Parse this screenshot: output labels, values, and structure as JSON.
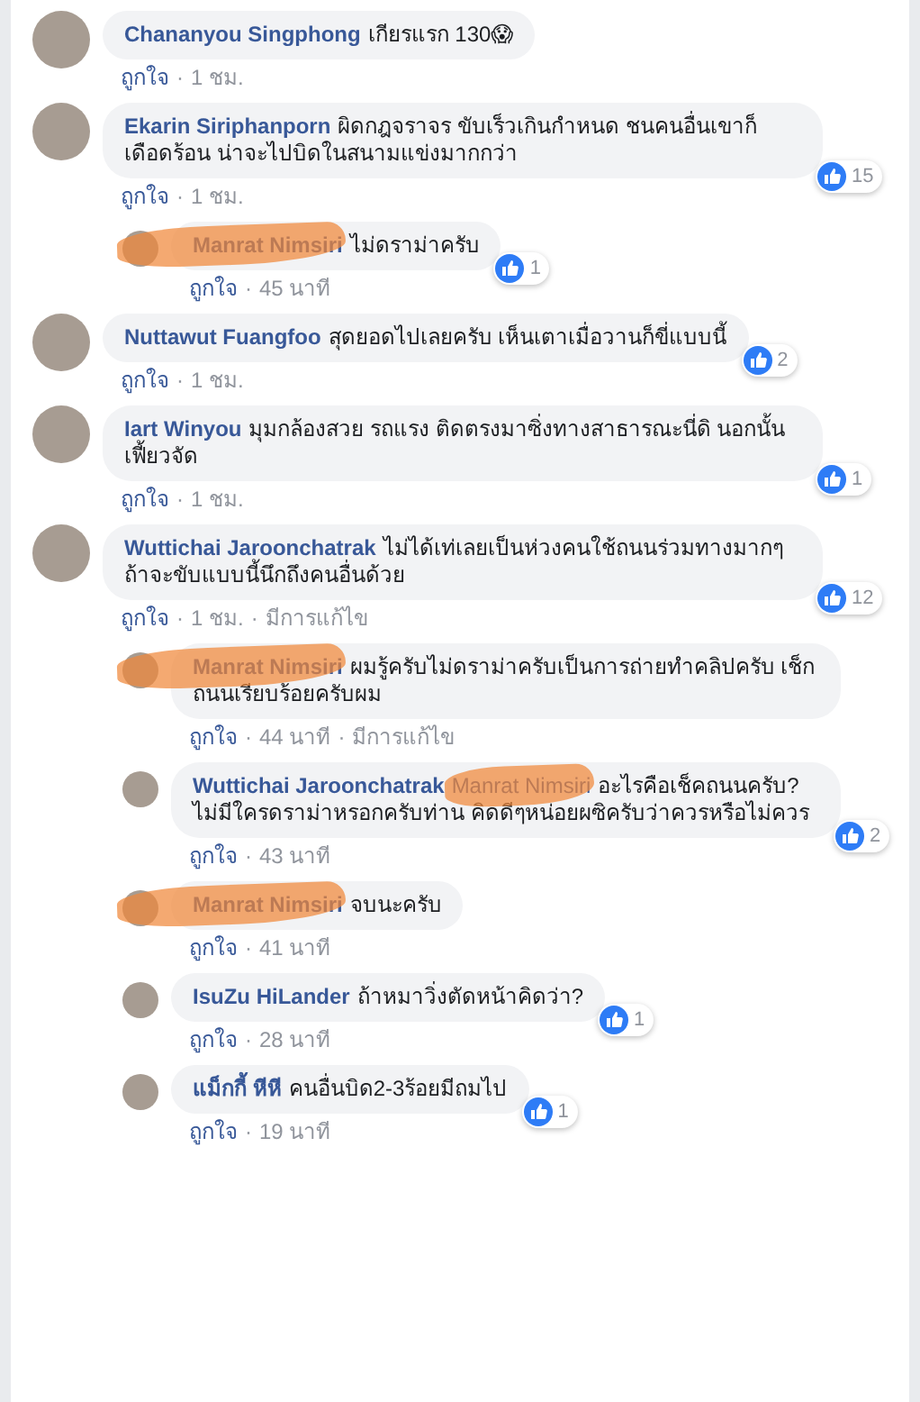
{
  "separator": "·",
  "comments": [
    {
      "author": "Chananyou Singphong",
      "text": "เกียรแรก 130😱",
      "like": "ถูกใจ",
      "time": "1 ชม."
    },
    {
      "author": "Ekarin Siriphanporn",
      "text": "ผิดกฎจราจร ขับเร็วเกินกำหนด ชนคนอื่นเขาก็เดือดร้อน น่าจะไปบิดในสนามแข่งมากกว่า",
      "like": "ถูกใจ",
      "time": "1 ชม.",
      "reactions": "15",
      "replies": [
        {
          "author": "Manrat Nimsiri",
          "text": "ไม่ดราม่าครับ",
          "like": "ถูกใจ",
          "time": "45 นาที",
          "reactions": "1",
          "redacted": true
        }
      ]
    },
    {
      "author": "Nuttawut Fuangfoo",
      "text": "สุดยอดไปเลยครับ เห็นเตาเมื่อวานก็ขี่แบบนี้",
      "like": "ถูกใจ",
      "time": "1 ชม.",
      "reactions": "2"
    },
    {
      "author": "Iart Winyou",
      "text": "มุมกล้องสวย รถแรง ติดตรงมาซิ่งทางสาธารณะนี่ดิ นอกนั้นเฟี้ยวจัด",
      "like": "ถูกใจ",
      "time": "1 ชม.",
      "reactions": "1"
    },
    {
      "author": "Wuttichai Jaroonchatrak",
      "text": "ไม่ได้เท่เลยเป็นห่วงคนใช้ถนนร่วมทางมากๆ ถ้าจะขับแบบนี้นึกถึงคนอื่นด้วย",
      "like": "ถูกใจ",
      "time": "1 ชม.",
      "edited": "มีการแก้ไข",
      "reactions": "12",
      "replies": [
        {
          "author": "Manrat Nimsiri",
          "text": "ผมรู้ครับไม่ดราม่าครับเป็นการถ่ายทำคลิปครับ เช็กถนนเรียบร้อยครับผม",
          "like": "ถูกใจ",
          "time": "44 นาที",
          "edited": "มีการแก้ไข",
          "redacted": true
        },
        {
          "author": "Wuttichai Jaroonchatrak",
          "mention": "Manrat Nimsiri",
          "mention_redacted": true,
          "text": "อะไรคือเช็คถนนครับ? ไม่มีใครดราม่าหรอกครับท่าน คิดดีๆหน่อยผซิครับว่าควรหรือไม่ควร",
          "like": "ถูกใจ",
          "time": "43 นาที",
          "reactions": "2"
        },
        {
          "author": "Manrat Nimsiri",
          "text": "จบนะครับ",
          "like": "ถูกใจ",
          "time": "41 นาที",
          "redacted": true
        },
        {
          "author": "IsuZu HiLander",
          "text": "ถ้าหมาวิ่งตัดหน้าคิดว่า?",
          "like": "ถูกใจ",
          "time": "28 นาที",
          "reactions": "1"
        },
        {
          "author": "แม็กกี้ หีหี",
          "text": "คนอื่นบิด2-3ร้อยมีถมไป",
          "like": "ถูกใจ",
          "time": "19 นาที",
          "reactions": "1"
        }
      ]
    }
  ]
}
